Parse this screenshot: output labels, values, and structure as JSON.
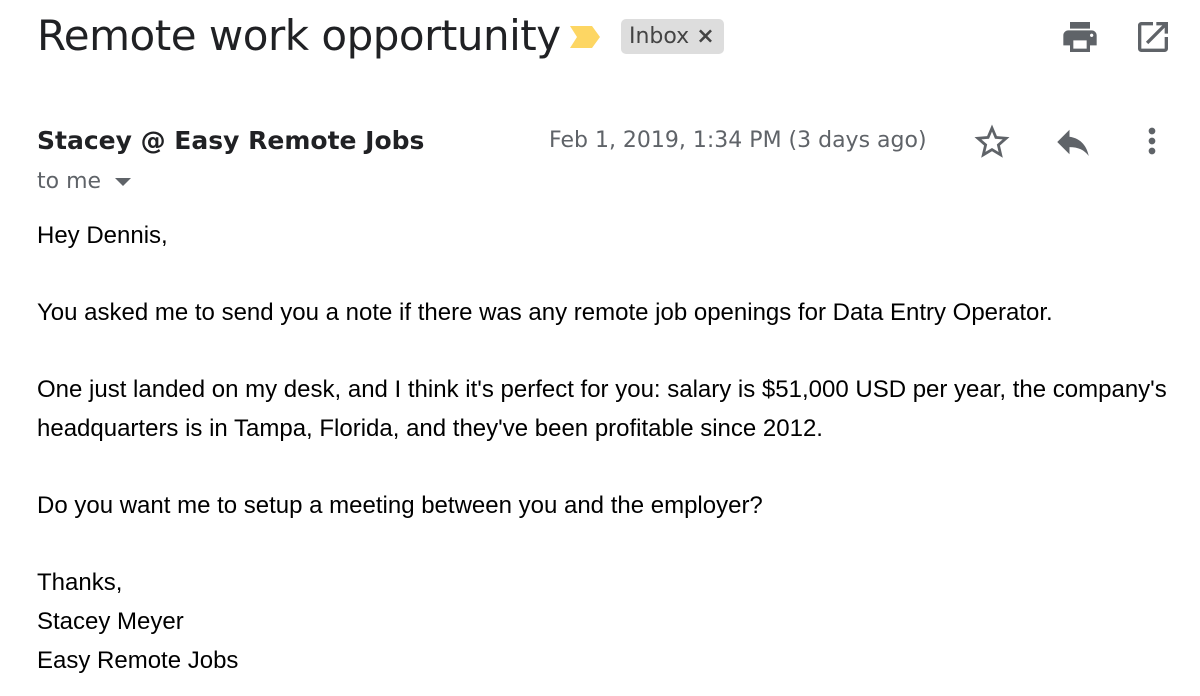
{
  "email": {
    "subject": "Remote work opportunity",
    "label": "Inbox",
    "label_close": "×",
    "sender": "Stacey @ Easy Remote Jobs",
    "date": "Feb 1, 2019, 1:34 PM (3 days ago)",
    "recipient": "to me",
    "greeting": "Hey Dennis,",
    "paragraph_1": "You asked me to send you a note if there was any remote job openings for Data Entry Operator.",
    "paragraph_2": "One just landed on my desk, and I think it's perfect for you: salary is $51,000 USD per year, the company's headquarters is in Tampa, Florida, and they've been profitable since 2012.",
    "paragraph_3": "Do you want me to setup a meeting between you and the employer?",
    "signoff": "Thanks,",
    "signature_name": "Stacey Meyer",
    "signature_company": "Easy Remote Jobs"
  },
  "icons": {
    "importance": "importance-marker-icon",
    "print": "print-icon",
    "popout": "open-in-new-window-icon",
    "star": "star-icon",
    "reply": "reply-icon",
    "more": "more-vert-icon",
    "recipient_caret": "caret-down-icon"
  },
  "colors": {
    "importance": "#fdd663",
    "chip_bg": "#dddddd",
    "icon": "#5f6368",
    "text": "#202124",
    "muted": "#5f6368"
  }
}
